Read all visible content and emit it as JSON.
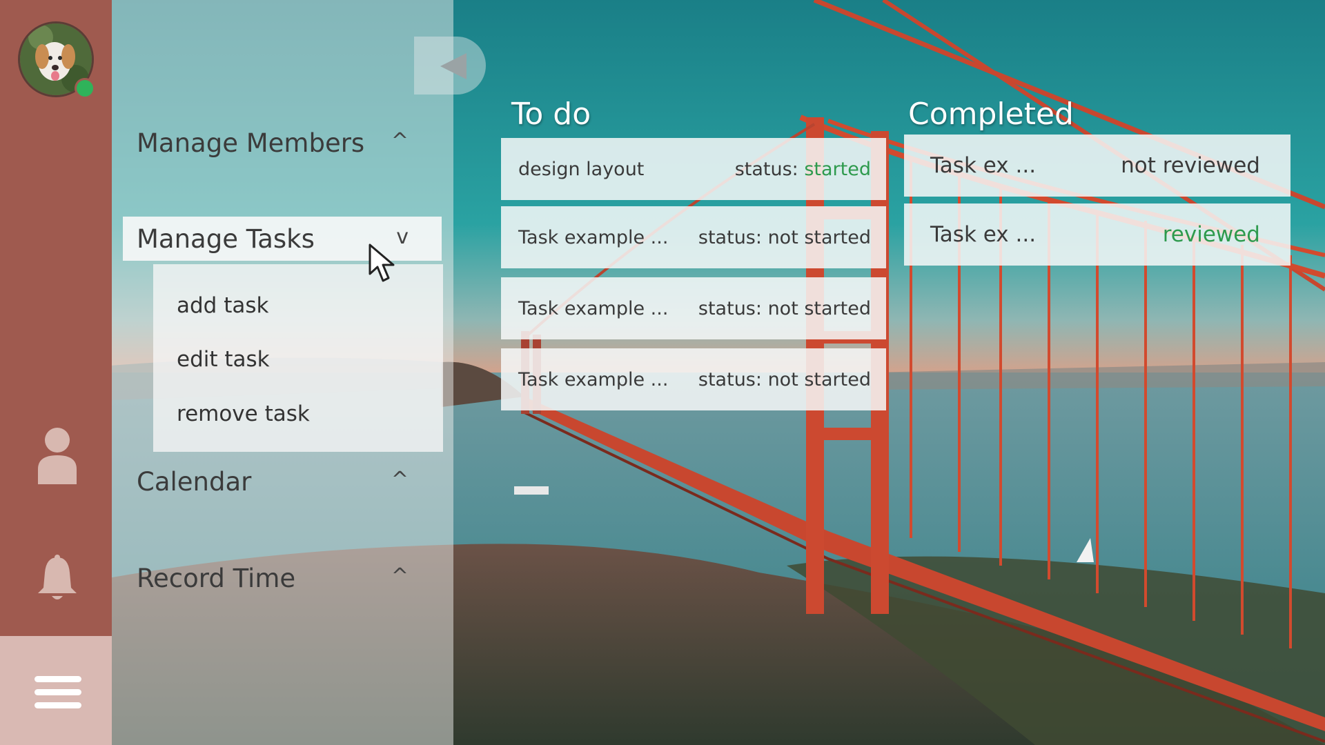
{
  "sidebar": {
    "avatar": {
      "status_color": "#2fb35a"
    },
    "icons": [
      "user-icon",
      "bell-icon",
      "hamburger-menu-icon"
    ]
  },
  "nav": {
    "items": [
      {
        "label": "Manage Members",
        "chevron": "^"
      },
      {
        "label": "Manage Tasks",
        "chevron": "v"
      },
      {
        "label": "Calendar",
        "chevron": "^"
      },
      {
        "label": "Record Time",
        "chevron": "^"
      }
    ],
    "submenu": [
      "add task",
      "edit task",
      "remove task"
    ]
  },
  "board": {
    "todo": {
      "title": "To do",
      "cards": [
        {
          "name": "design layout",
          "status_prefix": "status:",
          "status_value": "started"
        },
        {
          "name": "Task example ...",
          "status_prefix": "status:",
          "status_value": "not started"
        },
        {
          "name": "Task example ...",
          "status_prefix": "status:",
          "status_value": "not started"
        },
        {
          "name": "Task example ...",
          "status_prefix": "status:",
          "status_value": "not started"
        }
      ]
    },
    "completed": {
      "title": "Completed",
      "cards": [
        {
          "name": "Task ex ...",
          "status": "not reviewed"
        },
        {
          "name": "Task ex ...",
          "status": "reviewed"
        }
      ]
    }
  },
  "colors": {
    "rail": "#9f5a4f",
    "accent_green": "#2e9a4d",
    "sky": "#1f8e93",
    "bridge": "#d9462b"
  }
}
